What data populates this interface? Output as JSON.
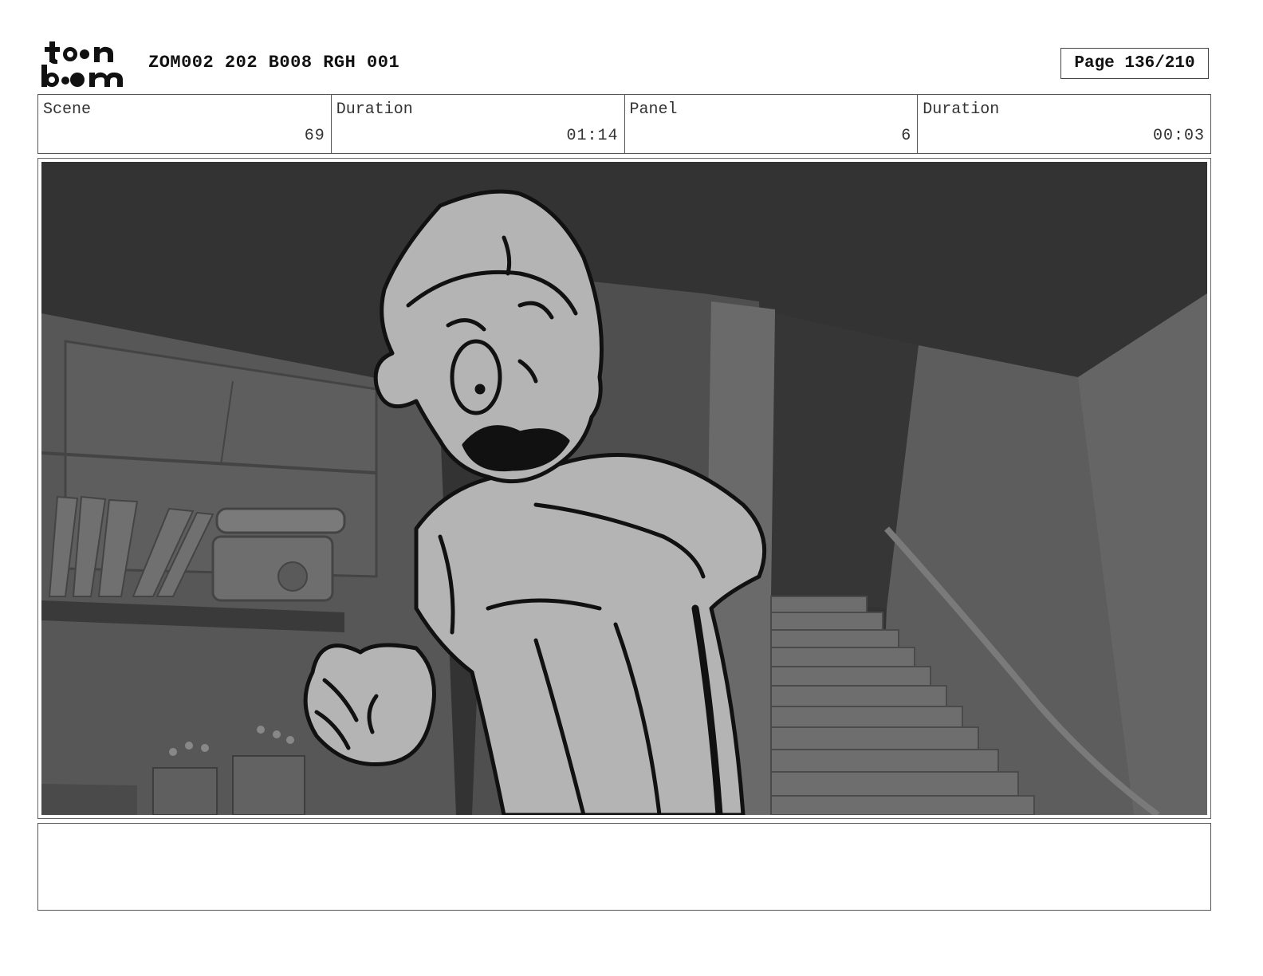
{
  "header": {
    "logo_text": "toon boom",
    "title": "ZOM002 202 B008 RGH 001",
    "page": "Page 136/210"
  },
  "info": {
    "scene_label": "Scene",
    "scene_value": "69",
    "scene_duration_label": "Duration",
    "scene_duration_value": "01:14",
    "panel_label": "Panel",
    "panel_value": "6",
    "panel_duration_label": "Duration",
    "panel_duration_value": "00:03"
  },
  "notes": {
    "text": ""
  }
}
